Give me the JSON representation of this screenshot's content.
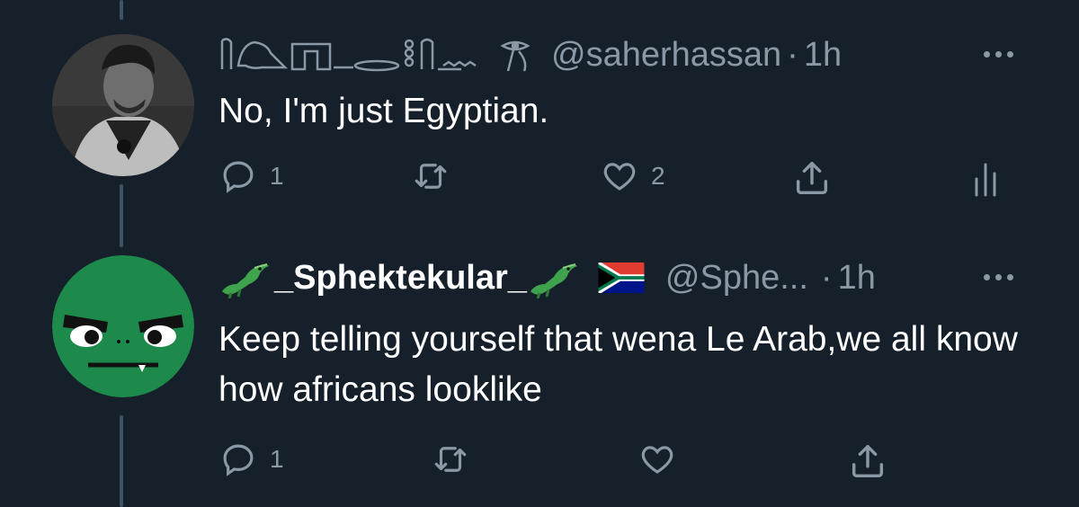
{
  "tweets": [
    {
      "display_name_glyphs": "𓅆𓊖𓏏𓂋𓈖 𓁹",
      "handle": "@saherhassan",
      "separator": "·",
      "time": "1h",
      "text": "No, I'm just Egyptian.",
      "replies": "1",
      "retweets": "",
      "likes": "2",
      "avatar": "person-photo-icon"
    },
    {
      "display_name": "_Sphektekular_",
      "emoji_left": "crocodile-icon",
      "emoji_right": "crocodile-icon",
      "flag": "south-africa-flag-icon",
      "handle": "@Sphe...",
      "separator": "·",
      "time": "1h",
      "text": "Keep telling yourself that wena Le Arab,we all know how africans looklike",
      "replies": "1",
      "retweets": "",
      "likes": "",
      "avatar": "green-angry-face-icon"
    }
  ],
  "colors": {
    "background": "#15202b",
    "muted": "#8b98a5",
    "text": "#ffffff",
    "thread_line": "#3d5466",
    "avatar_green": "#1d8a4b"
  }
}
